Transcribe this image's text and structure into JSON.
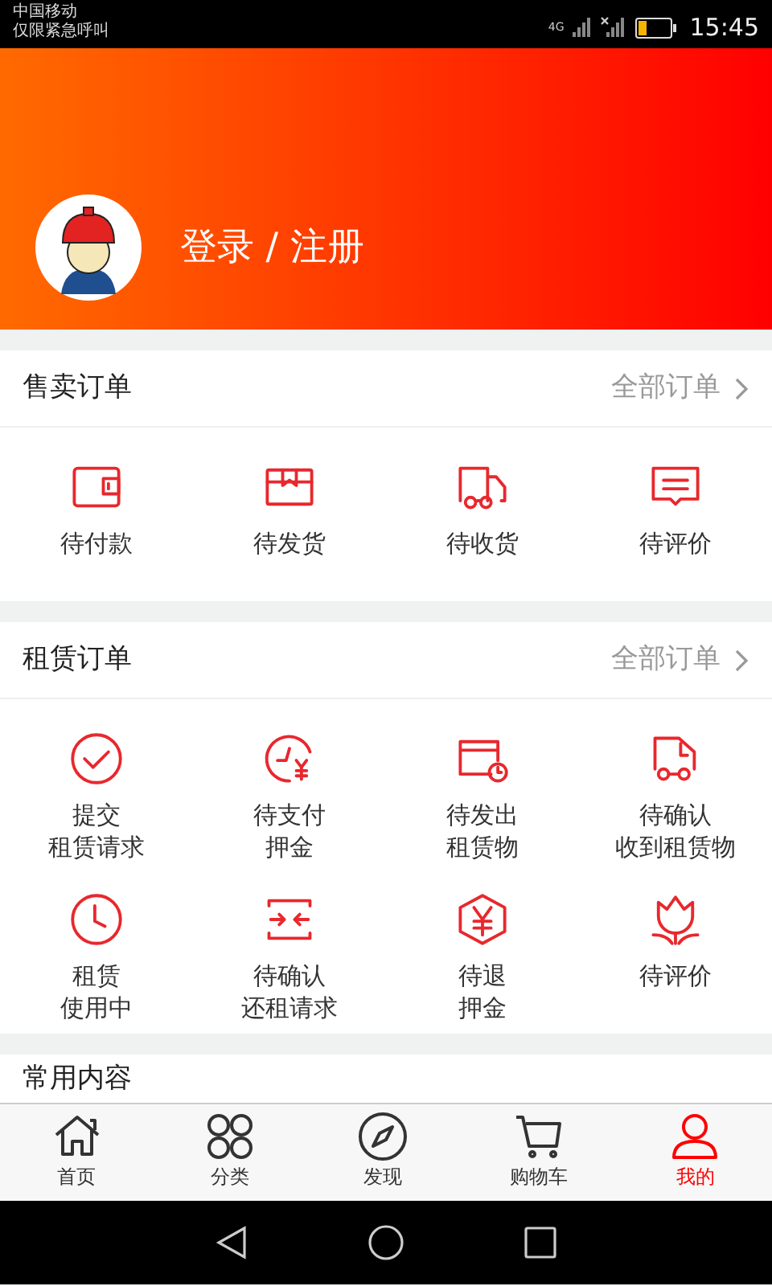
{
  "status_bar": {
    "carrier": "中国移动",
    "note": "仅限紧急呼叫",
    "network": "4G",
    "time": "15:45"
  },
  "profile": {
    "login_text": "登录 / 注册"
  },
  "sections": [
    {
      "title": "售卖订单",
      "link": "全部订单",
      "items": [
        {
          "label": "待付款"
        },
        {
          "label": "待发货"
        },
        {
          "label": "待收货"
        },
        {
          "label": "待评价"
        }
      ]
    },
    {
      "title": "租赁订单",
      "link": "全部订单",
      "items": [
        {
          "lines": [
            "提交",
            "租赁请求"
          ]
        },
        {
          "lines": [
            "待支付",
            "押金"
          ]
        },
        {
          "lines": [
            "待发出",
            "租赁物"
          ]
        },
        {
          "lines": [
            "待确认",
            "收到租赁物"
          ]
        },
        {
          "lines": [
            "租赁",
            "使用中"
          ]
        },
        {
          "lines": [
            "待确认",
            "还租请求"
          ]
        },
        {
          "lines": [
            "待退",
            "押金"
          ]
        },
        {
          "lines": [
            "待评价"
          ]
        }
      ]
    },
    {
      "title": "常用内容"
    }
  ],
  "tab_bar": [
    {
      "label": "首页",
      "selected": false
    },
    {
      "label": "分类",
      "selected": false
    },
    {
      "label": "发现",
      "selected": false
    },
    {
      "label": "购物车",
      "selected": false
    },
    {
      "label": "我的",
      "selected": true
    }
  ]
}
